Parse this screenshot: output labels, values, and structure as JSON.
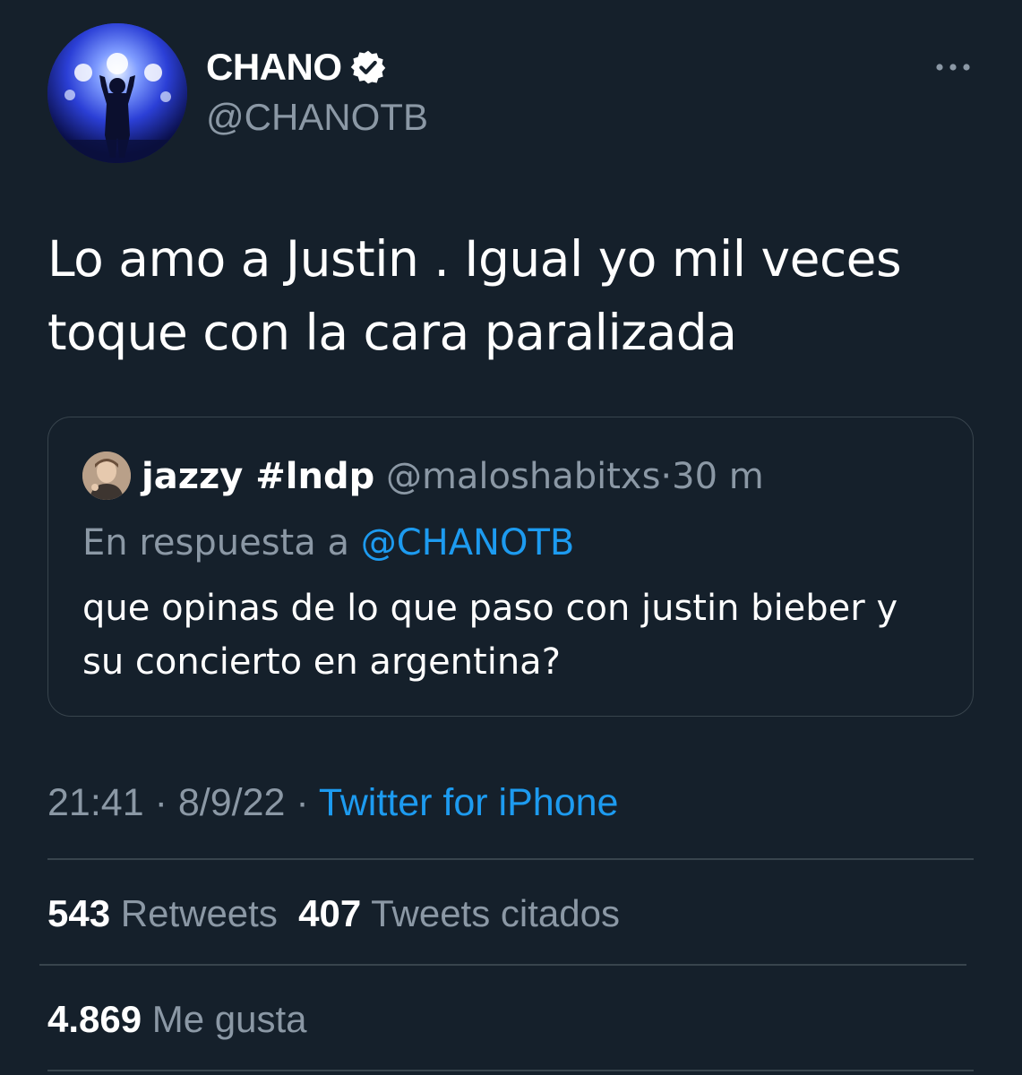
{
  "tweet": {
    "author": {
      "name": "CHANO",
      "handle": "@CHANOTB",
      "verified": true,
      "avatar": "concert-stage-avatar"
    },
    "more_icon": "more-horizontal-icon",
    "text_lines": [
      "Lo amo a Justin . Igual yo mil veces",
      "toque con la cara paralizada"
    ],
    "quoted": {
      "avatar": "user-avatar",
      "name": "jazzy #lndp",
      "handle": "@maloshabitxs",
      "separator": "·",
      "time": "30 m",
      "reply_prefix": "En respuesta a",
      "reply_to": "@CHANOTB",
      "text_lines": [
        "que opinas de lo que paso con justin bieber y",
        "su concierto en argentina?"
      ]
    },
    "meta": {
      "time": "21:41",
      "separator1": "·",
      "date": "8/9/22",
      "separator2": "·",
      "source": "Twitter for iPhone"
    },
    "stats": {
      "retweets_count": "543",
      "retweets_label": "Retweets",
      "quotes_count": "407",
      "quotes_label": "Tweets citados",
      "likes_count": "4.869",
      "likes_label": "Me gusta"
    }
  },
  "colors": {
    "background": "#15202b",
    "text_primary": "#ffffff",
    "text_secondary": "#8b98a5",
    "link": "#1d9bf0",
    "border": "#38444d"
  }
}
